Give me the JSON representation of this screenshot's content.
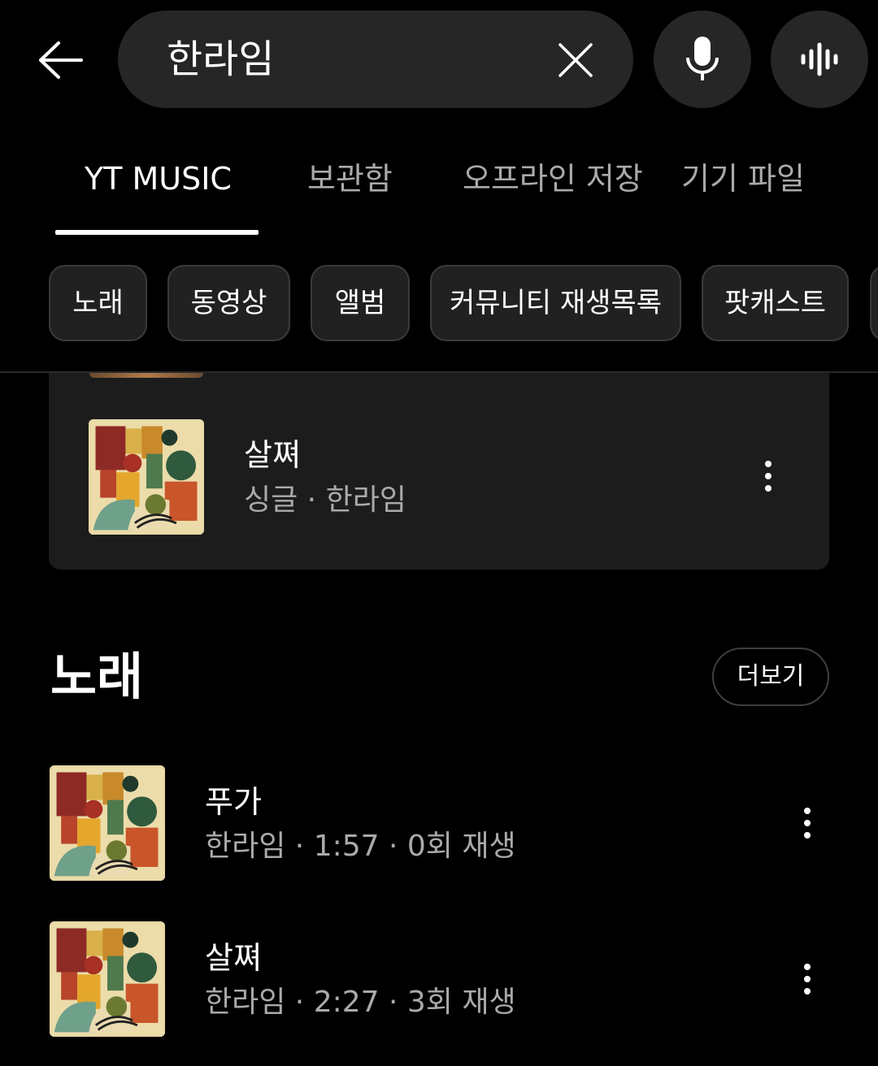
{
  "header": {
    "back_icon": "arrow-left-icon",
    "search_query": "한라임",
    "clear_icon": "close-icon",
    "mic_icon": "microphone-icon",
    "wave_icon": "sound-search-icon"
  },
  "tabs": [
    {
      "label": "YT MUSIC",
      "active": true
    },
    {
      "label": "보관함",
      "active": false
    },
    {
      "label": "오프라인 저장",
      "active": false
    },
    {
      "label": "기기 파일",
      "active": false
    }
  ],
  "chips": [
    "노래",
    "동영상",
    "앨범",
    "커뮤니티 재생목록",
    "팟캐스트"
  ],
  "top_result": {
    "title": "살쪄",
    "subtitle": "싱글 · 한라임"
  },
  "songs_section": {
    "title": "노래",
    "more_label": "더보기",
    "items": [
      {
        "title": "푸가",
        "subtitle": "한라임 · 1:57 · 0회 재생"
      },
      {
        "title": "살쪄",
        "subtitle": "한라임 · 2:27 · 3회 재생"
      }
    ]
  },
  "colors": {
    "background": "#000000",
    "pill": "#262626",
    "card": "#1c1c1c",
    "secondary_text": "#aaaaaa"
  }
}
